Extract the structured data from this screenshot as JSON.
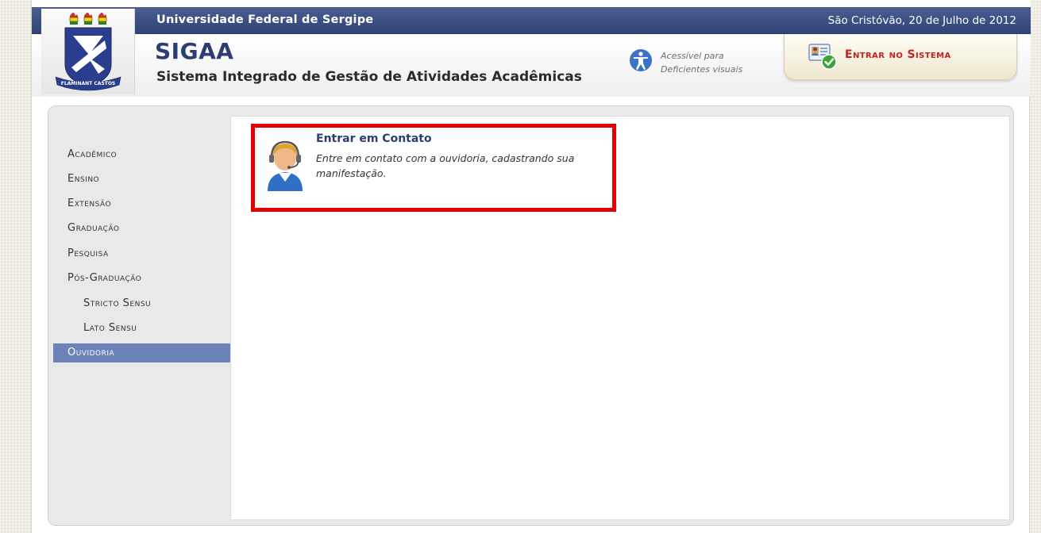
{
  "header": {
    "university": "Universidade Federal de Sergipe",
    "date": "São Cristóvão, 20 de Julho de 2012",
    "title": "SIGAA",
    "subtitle": "Sistema Integrado de Gestão de Atividades Acadêmicas",
    "logo_motto": "FLAMINANT CASTOS",
    "accessibility_line1": "Acessível para",
    "accessibility_line2": "Deficientes visuais",
    "accessibility_icon": "accessibility-icon",
    "login_label": "Entrar no Sistema",
    "login_icon": "user-card-check-icon"
  },
  "sidebar": {
    "items": [
      {
        "label": "Acadêmico",
        "sub": false
      },
      {
        "label": "Ensino",
        "sub": false
      },
      {
        "label": "Extensão",
        "sub": false
      },
      {
        "label": "Graduação",
        "sub": false
      },
      {
        "label": "Pesquisa",
        "sub": false
      },
      {
        "label": "Pós-Graduação",
        "sub": false
      },
      {
        "label": "Stricto Sensu",
        "sub": true
      },
      {
        "label": "Lato Sensu",
        "sub": true
      }
    ],
    "selected": "Ouvidoria"
  },
  "main": {
    "contact": {
      "icon": "headset-operator-icon",
      "title": "Entrar em Contato",
      "description": "Entre em contato com a ouvidoria, cadastrando sua manifestação."
    }
  },
  "colors": {
    "header_blue": "#2e4275",
    "highlight_red": "#e50000",
    "selected_menu": "#6c82b8",
    "login_text": "#c62020"
  }
}
